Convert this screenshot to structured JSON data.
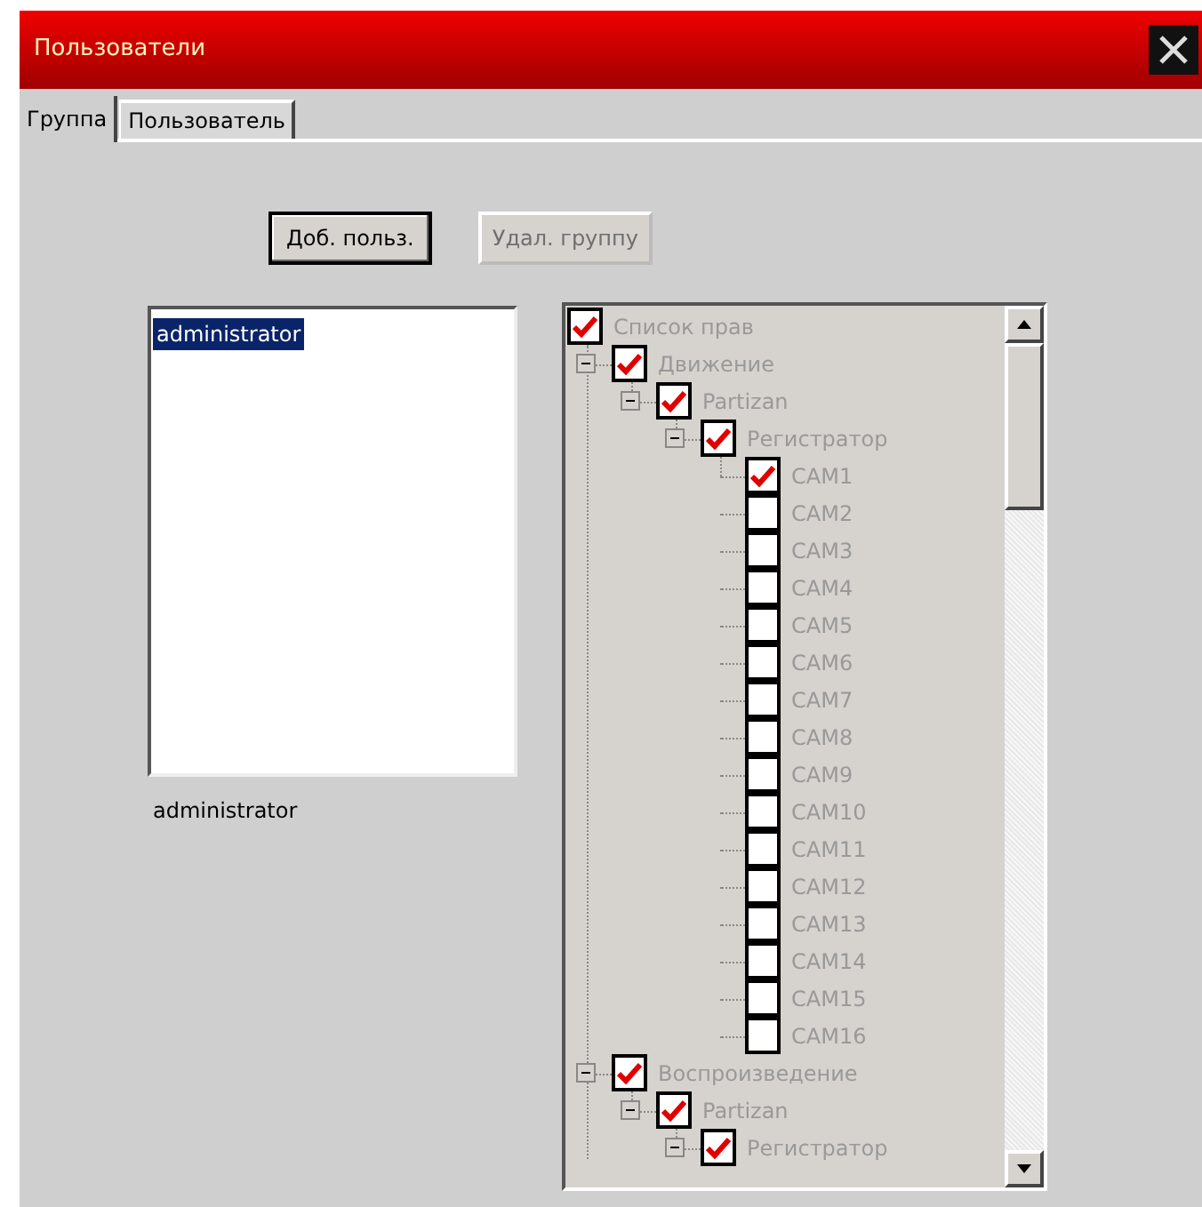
{
  "window": {
    "title": "Пользователи"
  },
  "tabs": [
    {
      "label": "Группа",
      "selected": true
    },
    {
      "label": "Пользователь",
      "selected": false
    }
  ],
  "buttons": [
    {
      "label": "Доб. польз.",
      "disabled": false
    },
    {
      "label": "Удал. группу",
      "disabled": true
    }
  ],
  "users_list": [
    {
      "label": "administrator",
      "selected": true
    }
  ],
  "user_name": "administrator",
  "rights_tree": [
    {
      "label": "Список прав",
      "checked": true,
      "children": [
        {
          "label": "Движение",
          "checked": true,
          "expanded": true,
          "children": [
            {
              "label": "Partizan",
              "checked": true,
              "expanded": true,
              "children": [
                {
                  "label": "Регистратор",
                  "checked": true,
                  "expanded": true,
                  "children": [
                    {
                      "label": "CAM1",
                      "checked": true
                    },
                    {
                      "label": "CAM2",
                      "checked": false
                    },
                    {
                      "label": "CAM3",
                      "checked": false
                    },
                    {
                      "label": "CAM4",
                      "checked": false
                    },
                    {
                      "label": "CAM5",
                      "checked": false
                    },
                    {
                      "label": "CAM6",
                      "checked": false
                    },
                    {
                      "label": "CAM7",
                      "checked": false
                    },
                    {
                      "label": "CAM8",
                      "checked": false
                    },
                    {
                      "label": "CAM9",
                      "checked": false
                    },
                    {
                      "label": "CAM10",
                      "checked": false
                    },
                    {
                      "label": "CAM11",
                      "checked": false
                    },
                    {
                      "label": "CAM12",
                      "checked": false
                    },
                    {
                      "label": "CAM13",
                      "checked": false
                    },
                    {
                      "label": "CAM14",
                      "checked": false
                    },
                    {
                      "label": "CAM15",
                      "checked": false
                    },
                    {
                      "label": "CAM16",
                      "checked": false
                    }
                  ]
                }
              ]
            }
          ]
        },
        {
          "label": "Воспроизведение",
          "checked": true,
          "expanded": true,
          "children": [
            {
              "label": "Partizan",
              "checked": true,
              "expanded": true,
              "children": [
                {
                  "label": "Регистратор",
                  "checked": true,
                  "expanded": true
                }
              ]
            }
          ]
        }
      ]
    }
  ]
}
